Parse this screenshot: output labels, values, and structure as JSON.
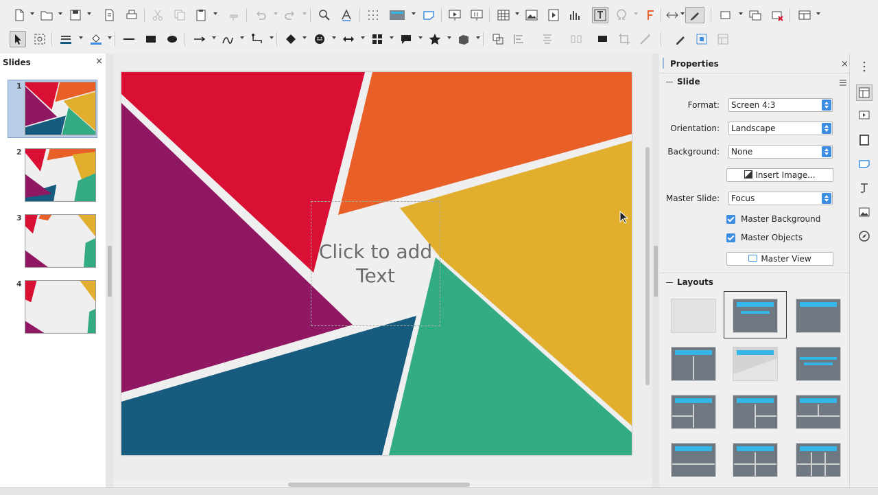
{
  "toolbar_row1": {
    "icons": [
      "new-icon",
      "open-icon",
      "save-icon",
      "export-pdf-icon",
      "print-icon",
      "cut-icon",
      "copy-icon",
      "paste-icon",
      "clone-formatting-icon",
      "undo-icon",
      "redo-icon",
      "find-icon",
      "spelling-icon",
      "grid-icon",
      "display-views-icon",
      "master-slide-icon",
      "start-first-slide-icon",
      "start-current-slide-icon",
      "table-icon",
      "image-icon",
      "media-icon",
      "chart-icon",
      "text-box-icon",
      "special-character-icon",
      "fontwork-icon",
      "transitions-icon",
      "line-color-icon",
      "show-draw-functions-icon",
      "new-slide-icon",
      "duplicate-slide-icon",
      "delete-slide-icon",
      "slide-layout-icon"
    ]
  },
  "toolbar_row2": {
    "icons": [
      "select-icon",
      "zoom-pan-icon",
      "line-style-icon",
      "fill-color-icon",
      "line-icon",
      "rectangle-icon",
      "ellipse-icon",
      "line-arrow-icon",
      "curve-icon",
      "connector-icon",
      "basic-shapes-icon",
      "symbol-shapes-icon",
      "block-arrows-icon",
      "flowchart-icon",
      "callouts-icon",
      "stars-icon",
      "3d-objects-icon",
      "transformations-icon",
      "align-icon",
      "arrange-icon",
      "distribute-icon",
      "shadow-icon",
      "crop-icon",
      "filter-icon",
      "toggle-extrusion-icon",
      "glue-points-icon",
      "select-at-least-three-icon"
    ]
  },
  "slides_panel": {
    "title": "Slides",
    "close": "×",
    "slides": [
      {
        "number": "1"
      },
      {
        "number": "2"
      },
      {
        "number": "3"
      },
      {
        "number": "4"
      }
    ]
  },
  "slide": {
    "placeholder_text_line1": "Click to add",
    "placeholder_text_line2": "Text",
    "colors": {
      "red": "#d91034",
      "orange": "#e95f28",
      "yellow": "#e2ae2d",
      "teal": "#33ac85",
      "blue": "#175b7e",
      "purple": "#901863",
      "background": "#efefef"
    }
  },
  "properties": {
    "title": "Properties",
    "close": "×",
    "slide_section": {
      "heading": "Slide",
      "format_label": "Format:",
      "format_value": "Screen 4:3",
      "orientation_label": "Orientation:",
      "orientation_value": "Landscape",
      "background_label": "Background:",
      "background_value": "None",
      "insert_image_label": "Insert Image...",
      "master_slide_label": "Master Slide:",
      "master_slide_value": "Focus",
      "master_background_label": "Master Background",
      "master_background_checked": true,
      "master_objects_label": "Master Objects",
      "master_objects_checked": true,
      "master_view_label": "Master View"
    },
    "layouts_section": {
      "heading": "Layouts",
      "layouts": [
        "blank-slide",
        "title-content",
        "title-only-top",
        "title-2-content",
        "title-slide-diagonal",
        "centered-text",
        "title-4-content-left",
        "title-4-content-right",
        "title-6-content-row",
        "title-6-content-a",
        "title-6-content-b",
        "title-6-content-grid"
      ],
      "selected_index": 1
    }
  },
  "sidebar_deck": {
    "icons": [
      "properties-deck-icon",
      "slide-transition-deck-icon",
      "animation-deck-icon",
      "master-slides-deck-icon",
      "styles-deck-icon",
      "gallery-deck-icon",
      "navigator-deck-icon"
    ]
  },
  "accent_color": "#3d8ee0"
}
